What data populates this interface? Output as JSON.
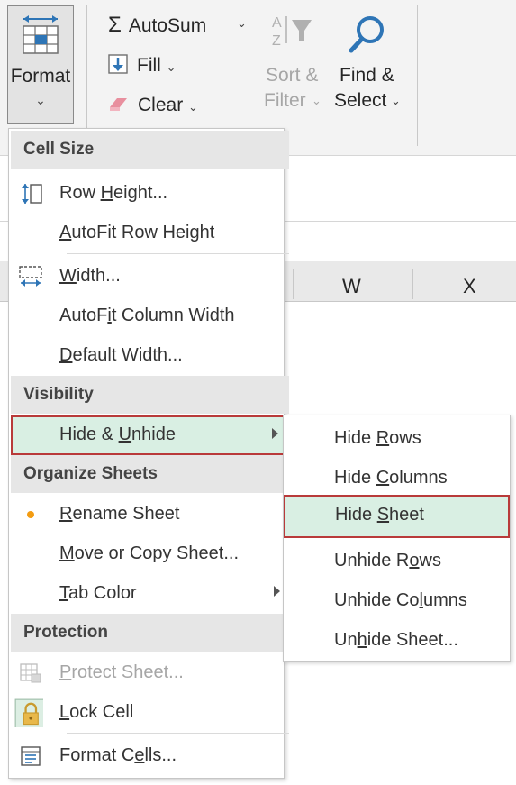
{
  "ribbon": {
    "format": {
      "label": "Format",
      "chevron": "⌄"
    },
    "autosum": {
      "glyph": "Σ",
      "label": "AutoSum",
      "caret": "⌄"
    },
    "fill": {
      "label": "Fill",
      "caret": "⌄"
    },
    "clear": {
      "label": "Clear",
      "caret": "⌄"
    },
    "sort_filter": {
      "line1": "Sort &",
      "line2": "Filter",
      "caret": "⌄"
    },
    "find_select": {
      "line1": "Find &",
      "line2": "Select",
      "caret": "⌄"
    }
  },
  "columns": [
    "W",
    "X"
  ],
  "menu": {
    "sections": {
      "cell_size": "Cell Size",
      "visibility": "Visibility",
      "organize": "Organize Sheets",
      "protection": "Protection"
    },
    "items": {
      "row_height": {
        "pre": "Row ",
        "u": "H",
        "post": "eight..."
      },
      "autofit_row": {
        "pre": "",
        "u": "A",
        "post": "utoFit Row Height"
      },
      "width": {
        "pre": "",
        "u": "W",
        "post": "idth..."
      },
      "autofit_col": {
        "pre": "AutoF",
        "u": "i",
        "post": "t Column Width"
      },
      "default_width": {
        "pre": "",
        "u": "D",
        "post": "efault Width..."
      },
      "hide_unhide": {
        "pre": "Hide & ",
        "u": "U",
        "post": "nhide"
      },
      "rename": {
        "pre": "",
        "u": "R",
        "post": "ename Sheet"
      },
      "move_copy": {
        "pre": "",
        "u": "M",
        "post": "ove or Copy Sheet..."
      },
      "tab_color": {
        "pre": "",
        "u": "T",
        "post": "ab Color"
      },
      "protect": {
        "pre": "",
        "u": "P",
        "post": "rotect Sheet..."
      },
      "lock_cell": {
        "pre": "",
        "u": "L",
        "post": "ock Cell"
      },
      "format_cells": {
        "pre": "Format C",
        "u": "e",
        "post": "lls..."
      }
    }
  },
  "submenu": {
    "hide_rows": {
      "pre": "Hide ",
      "u": "R",
      "post": "ows"
    },
    "hide_columns": {
      "pre": "Hide ",
      "u": "C",
      "post": "olumns"
    },
    "hide_sheet": {
      "pre": "Hide ",
      "u": "S",
      "post": "heet"
    },
    "unhide_rows": {
      "pre": "Unhide R",
      "u": "o",
      "post": "ws"
    },
    "unhide_columns": {
      "pre": "Unhide Co",
      "u": "l",
      "post": "umns"
    },
    "unhide_sheet": {
      "pre": "Un",
      "u": "h",
      "post": "ide Sheet..."
    }
  },
  "colors": {
    "highlight": "#d9efe3",
    "highlight_border": "#b93a3a",
    "accent_blue": "#2e75b6",
    "rename_dot": "#f39c12"
  }
}
